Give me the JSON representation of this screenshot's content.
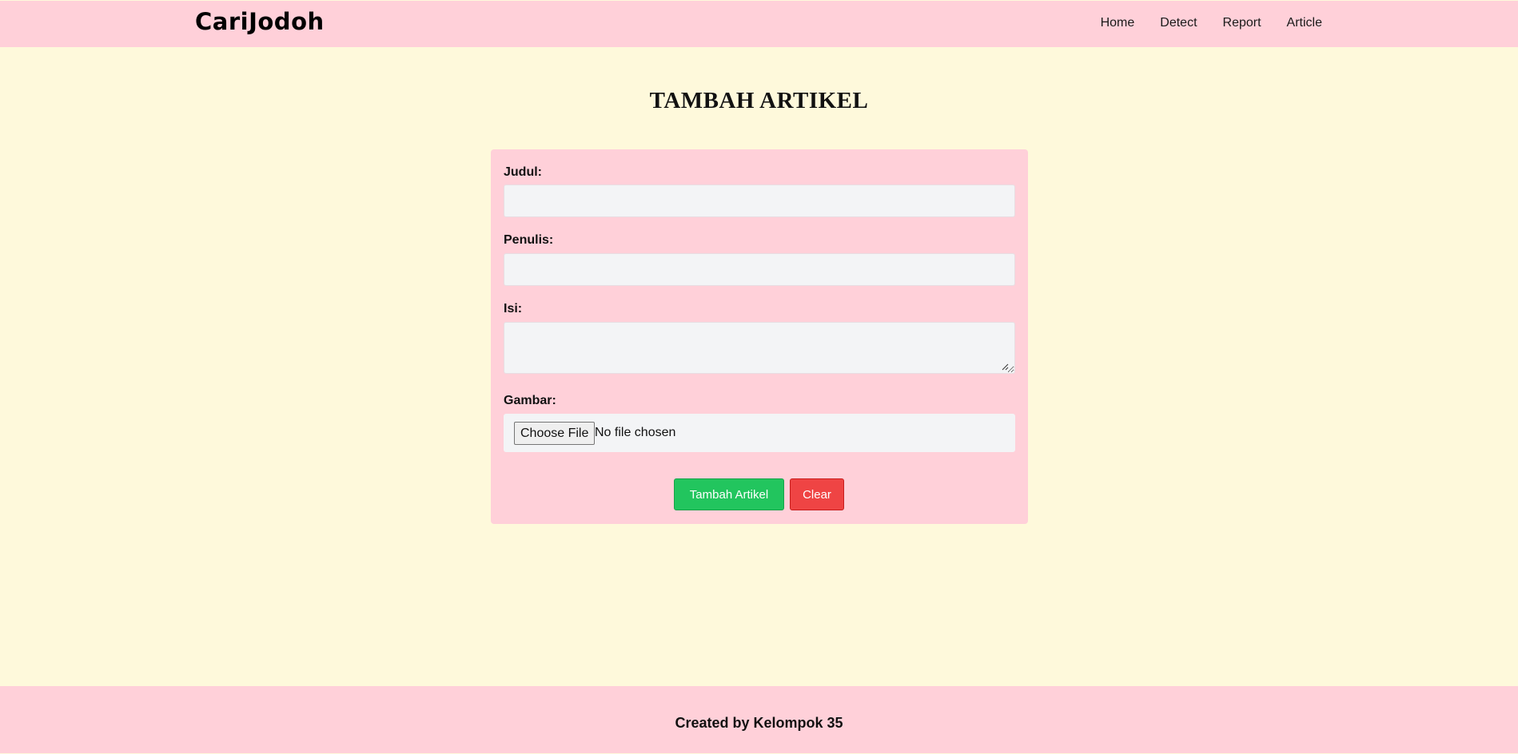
{
  "navbar": {
    "brand": "CariJodoh",
    "links": [
      "Home",
      "Detect",
      "Report",
      "Article"
    ]
  },
  "page_title": "TAMBAH ARTIKEL",
  "form": {
    "judul_label": "Judul:",
    "judul_value": "",
    "penulis_label": "Penulis:",
    "penulis_value": "",
    "isi_label": "Isi:",
    "isi_value": "",
    "gambar_label": "Gambar:",
    "file_button_label": "Choose File",
    "file_status": "No file chosen",
    "submit_label": "Tambah Artikel",
    "clear_label": "Clear"
  },
  "footer": {
    "text": "Created by Kelompok 35"
  },
  "colors": {
    "page_background": "#fef9db",
    "bar_background": "#ffd0d9",
    "input_background": "#f3f4f6",
    "submit_button": "#22c55e",
    "clear_button": "#ef4444"
  },
  "icons": {
    "resize_grip": "resize-grip-icon"
  }
}
